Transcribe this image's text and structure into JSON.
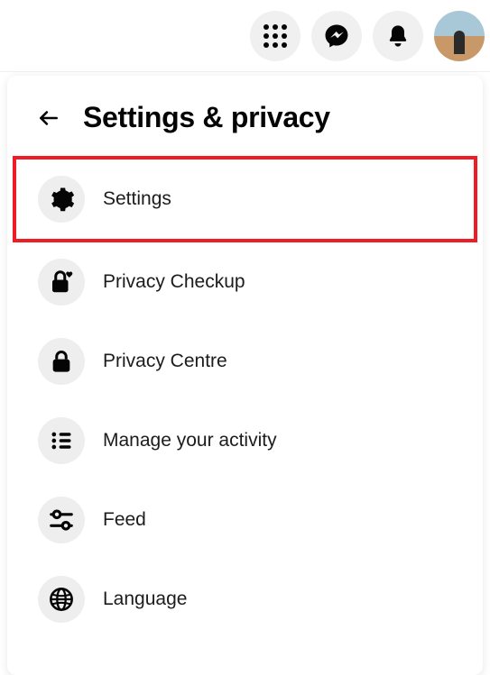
{
  "panel": {
    "title": "Settings & privacy"
  },
  "menu": {
    "items": [
      {
        "label": "Settings"
      },
      {
        "label": "Privacy Checkup"
      },
      {
        "label": "Privacy Centre"
      },
      {
        "label": "Manage your activity"
      },
      {
        "label": "Feed"
      },
      {
        "label": "Language"
      }
    ]
  }
}
